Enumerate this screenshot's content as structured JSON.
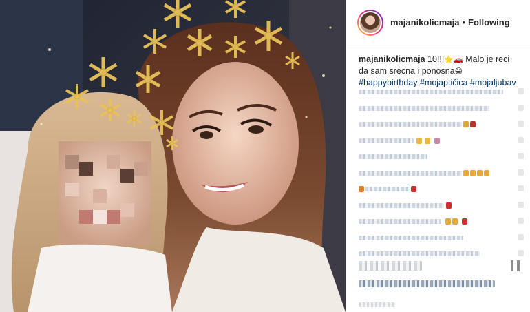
{
  "post": {
    "username": "majanikolicmaja",
    "separator": "•",
    "follow_status": "Following",
    "caption": {
      "username": "majanikolicmaja",
      "text_part1": " 10!!!",
      "emoji_star": "⭐",
      "emoji_car": "🚗",
      "text_part2": " Malo je reci da sam srecna i ponosna",
      "emoji_face": "😁",
      "hashtags": [
        "#happybirthday",
        "#mojaptičica",
        "#mojaljubav"
      ]
    }
  },
  "icons": {
    "avatar": "profile-avatar",
    "bookmark": "bookmark-icon"
  },
  "colors": {
    "link": "#003569",
    "text": "#262626",
    "border": "#efefef",
    "snowflake": "#e8c25a"
  }
}
